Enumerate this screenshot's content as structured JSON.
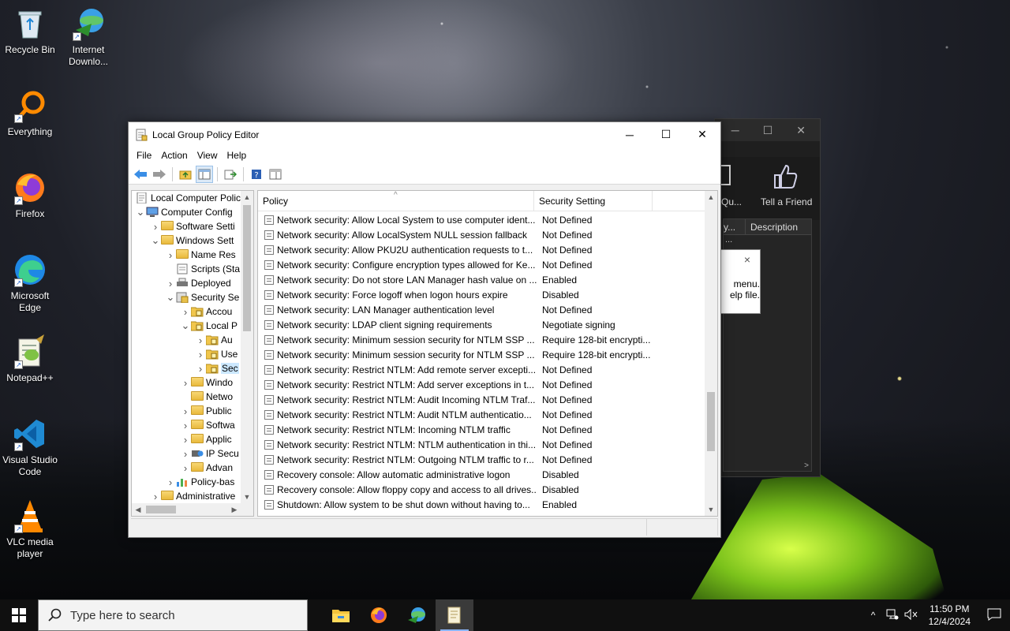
{
  "desktop": {
    "icons": [
      {
        "label": "Recycle Bin"
      },
      {
        "label": "Internet Downlo..."
      },
      {
        "label": "Everything"
      },
      {
        "label": "Firefox"
      },
      {
        "label": "Microsoft Edge"
      },
      {
        "label": "Notepad++"
      },
      {
        "label": "Visual Studio Code"
      },
      {
        "label": "VLC media player"
      }
    ]
  },
  "bg_window": {
    "tell_friend": "Tell a Friend",
    "qu_label": "Qu...",
    "col_left": "y...",
    "col_desc": "Description",
    "popup_line1": "menu.",
    "popup_line2": "elp file.",
    "close_glyph": "×",
    "row_dots": "..."
  },
  "window": {
    "title": "Local Group Policy Editor",
    "minimize": "─",
    "maximize": "☐",
    "close": "✕"
  },
  "menu": [
    "File",
    "Action",
    "View",
    "Help"
  ],
  "tree": [
    {
      "label": "Local Computer Polic",
      "level": 0,
      "exp": "",
      "icon": "policy"
    },
    {
      "label": "Computer Config",
      "level": 0,
      "exp": "v",
      "icon": "computer"
    },
    {
      "label": "Software Setti",
      "level": 1,
      "exp": ">",
      "icon": "folder"
    },
    {
      "label": "Windows Sett",
      "level": 1,
      "exp": "v",
      "icon": "folder"
    },
    {
      "label": "Name Res",
      "level": 2,
      "exp": ">",
      "icon": "folder"
    },
    {
      "label": "Scripts (Sta",
      "level": 2,
      "exp": "",
      "icon": "script"
    },
    {
      "label": "Deployed",
      "level": 2,
      "exp": ">",
      "icon": "printer"
    },
    {
      "label": "Security Se",
      "level": 2,
      "exp": "v",
      "icon": "security"
    },
    {
      "label": "Accou",
      "level": 3,
      "exp": ">",
      "icon": "lockfolder"
    },
    {
      "label": "Local P",
      "level": 3,
      "exp": "v",
      "icon": "lockfolder"
    },
    {
      "label": "Au",
      "level": 4,
      "exp": ">",
      "icon": "lockfolder"
    },
    {
      "label": "Use",
      "level": 4,
      "exp": ">",
      "icon": "lockfolder"
    },
    {
      "label": "Sec",
      "level": 4,
      "exp": ">",
      "icon": "lockfolder",
      "selected": true
    },
    {
      "label": "Windo",
      "level": 3,
      "exp": ">",
      "icon": "folder"
    },
    {
      "label": "Netwo",
      "level": 3,
      "exp": "",
      "icon": "folder"
    },
    {
      "label": "Public",
      "level": 3,
      "exp": ">",
      "icon": "folder"
    },
    {
      "label": "Softwa",
      "level": 3,
      "exp": ">",
      "icon": "folder"
    },
    {
      "label": "Applic",
      "level": 3,
      "exp": ">",
      "icon": "folder"
    },
    {
      "label": "IP Secu",
      "level": 3,
      "exp": ">",
      "icon": "ipsec"
    },
    {
      "label": "Advan",
      "level": 3,
      "exp": ">",
      "icon": "folder"
    },
    {
      "label": "Policy-bas",
      "level": 2,
      "exp": ">",
      "icon": "chart"
    },
    {
      "label": "Administrative",
      "level": 1,
      "exp": ">",
      "icon": "folder"
    }
  ],
  "list": {
    "col_policy": "Policy",
    "col_setting": "Security Setting",
    "sort_glyph": "^",
    "rows": [
      {
        "policy": "Network security: Allow Local System to use computer ident...",
        "setting": "Not Defined"
      },
      {
        "policy": "Network security: Allow LocalSystem NULL session fallback",
        "setting": "Not Defined"
      },
      {
        "policy": "Network security: Allow PKU2U authentication requests to t...",
        "setting": "Not Defined"
      },
      {
        "policy": "Network security: Configure encryption types allowed for Ke...",
        "setting": "Not Defined"
      },
      {
        "policy": "Network security: Do not store LAN Manager hash value on ...",
        "setting": "Enabled"
      },
      {
        "policy": "Network security: Force logoff when logon hours expire",
        "setting": "Disabled"
      },
      {
        "policy": "Network security: LAN Manager authentication level",
        "setting": "Not Defined"
      },
      {
        "policy": "Network security: LDAP client signing requirements",
        "setting": "Negotiate signing"
      },
      {
        "policy": "Network security: Minimum session security for NTLM SSP ...",
        "setting": "Require 128-bit encrypti..."
      },
      {
        "policy": "Network security: Minimum session security for NTLM SSP ...",
        "setting": "Require 128-bit encrypti..."
      },
      {
        "policy": "Network security: Restrict NTLM: Add remote server excepti...",
        "setting": "Not Defined"
      },
      {
        "policy": "Network security: Restrict NTLM: Add server exceptions in t...",
        "setting": "Not Defined"
      },
      {
        "policy": "Network security: Restrict NTLM: Audit Incoming NTLM Traf...",
        "setting": "Not Defined"
      },
      {
        "policy": "Network security: Restrict NTLM: Audit NTLM authenticatio...",
        "setting": "Not Defined"
      },
      {
        "policy": "Network security: Restrict NTLM: Incoming NTLM traffic",
        "setting": "Not Defined"
      },
      {
        "policy": "Network security: Restrict NTLM: NTLM authentication in thi...",
        "setting": "Not Defined"
      },
      {
        "policy": "Network security: Restrict NTLM: Outgoing NTLM traffic to r...",
        "setting": "Not Defined"
      },
      {
        "policy": "Recovery console: Allow automatic administrative logon",
        "setting": "Disabled"
      },
      {
        "policy": "Recovery console: Allow floppy copy and access to all drives...",
        "setting": "Disabled"
      },
      {
        "policy": "Shutdown: Allow system to be shut down without having to...",
        "setting": "Enabled"
      }
    ]
  },
  "taskbar": {
    "search_placeholder": "Type here to search",
    "time": "11:50 PM",
    "date": "12/4/2024",
    "tray_chevron": "^"
  },
  "colors": {
    "accent": "#0078d7",
    "taskbar": "#101010",
    "selected_tree": "#cce8ff"
  }
}
